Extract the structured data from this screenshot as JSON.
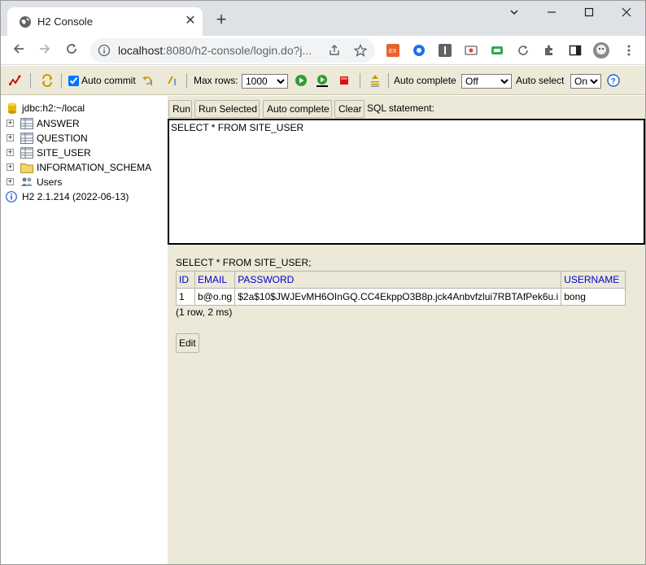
{
  "browser": {
    "tab_title": "H2 Console",
    "new_tab": "+",
    "close_tab": "✕",
    "url_host": "localhost",
    "url_rest": ":8080/h2-console/login.do?j..."
  },
  "toolbar": {
    "auto_commit_label": "Auto commit",
    "auto_commit_checked": true,
    "max_rows_label": "Max rows:",
    "max_rows_value": "1000",
    "auto_complete_label": "Auto complete",
    "auto_complete_value": "Off",
    "auto_select_label": "Auto select",
    "auto_select_value": "On"
  },
  "tree": {
    "connection": "jdbc:h2:~/local",
    "items": [
      {
        "label": "ANSWER",
        "icon": "table-icon"
      },
      {
        "label": "QUESTION",
        "icon": "table-icon"
      },
      {
        "label": "SITE_USER",
        "icon": "table-icon"
      },
      {
        "label": "INFORMATION_SCHEMA",
        "icon": "folder-icon"
      },
      {
        "label": "Users",
        "icon": "users-icon"
      }
    ],
    "version": "H2 2.1.214 (2022-06-13)"
  },
  "query": {
    "buttons": [
      "Run",
      "Run Selected",
      "Auto complete",
      "Clear"
    ],
    "sql_label": "SQL statement:",
    "sql_text": "SELECT * FROM SITE_USER"
  },
  "result": {
    "sql_echo": "SELECT * FROM SITE_USER;",
    "columns": [
      "ID",
      "EMAIL",
      "PASSWORD",
      "USERNAME"
    ],
    "rows": [
      [
        "1",
        "b@o.ng",
        "$2a$10$JWJEvMH6OInGQ.CC4EkppO3B8p.jck4Anbvfzlui7RBTAfPek6u.i",
        "bong"
      ]
    ],
    "row_count": "(1 row, 2 ms)",
    "edit_label": "Edit"
  },
  "colors": {
    "panel_bg": "#ece9d8",
    "header_text": "#0000cc",
    "chrome_tabstrip": "#dee1e6"
  }
}
